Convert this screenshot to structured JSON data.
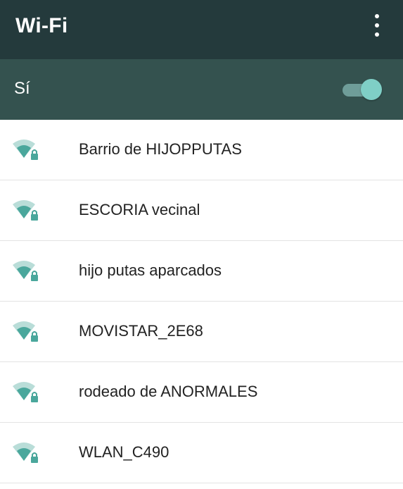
{
  "toolbar": {
    "title": "Wi-Fi",
    "menu_icon": "more-vert-icon"
  },
  "master_switch": {
    "label": "Sí",
    "state": "on"
  },
  "colors": {
    "toolbar_bg": "#243a3c",
    "switch_bar_bg": "#34524f",
    "accent": "#7fcfc6",
    "wifi_icon": "#4aa79c"
  },
  "networks": [
    {
      "ssid": "Barrio de HIJOPPUTAS",
      "icon": "wifi-lock-icon",
      "secured": true
    },
    {
      "ssid": "ESCORIA vecinal",
      "icon": "wifi-lock-icon",
      "secured": true
    },
    {
      "ssid": "hijo putas aparcados",
      "icon": "wifi-lock-icon",
      "secured": true
    },
    {
      "ssid": "MOVISTAR_2E68",
      "icon": "wifi-lock-icon",
      "secured": true
    },
    {
      "ssid": "rodeado de ANORMALES",
      "icon": "wifi-lock-icon",
      "secured": true
    },
    {
      "ssid": "WLAN_C490",
      "icon": "wifi-lock-icon",
      "secured": true
    }
  ]
}
